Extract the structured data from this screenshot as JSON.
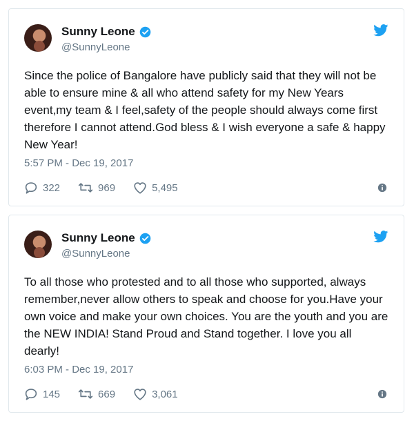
{
  "tweets": [
    {
      "name": "Sunny Leone",
      "handle": "@SunnyLeone",
      "text": "Since the police of Bangalore have publicly said that they will not be able to ensure mine & all who attend safety for my New Years event,my team & I feel,safety of the people should always come first therefore I cannot attend.God bless & I wish everyone a safe & happy New Year!",
      "timestamp": "5:57 PM - Dec 19, 2017",
      "replies": "322",
      "retweets": "969",
      "likes": "5,495"
    },
    {
      "name": "Sunny Leone",
      "handle": "@SunnyLeone",
      "text": "To all those who protested and to all those who supported, always remember,never allow others to speak and choose for you.Have your own voice and make your own choices. You are the youth and you are the NEW INDIA! Stand Proud and Stand together. I love you all dearly!",
      "timestamp": "6:03 PM - Dec 19, 2017",
      "replies": "145",
      "retweets": "669",
      "likes": "3,061"
    }
  ],
  "colors": {
    "twitter_blue": "#1da1f2",
    "muted": "#657786",
    "text": "#14171a",
    "border": "#e1e8ed"
  },
  "icons": [
    "verified-badge-icon",
    "twitter-bird-icon",
    "reply-icon",
    "retweet-icon",
    "like-icon",
    "info-icon"
  ]
}
